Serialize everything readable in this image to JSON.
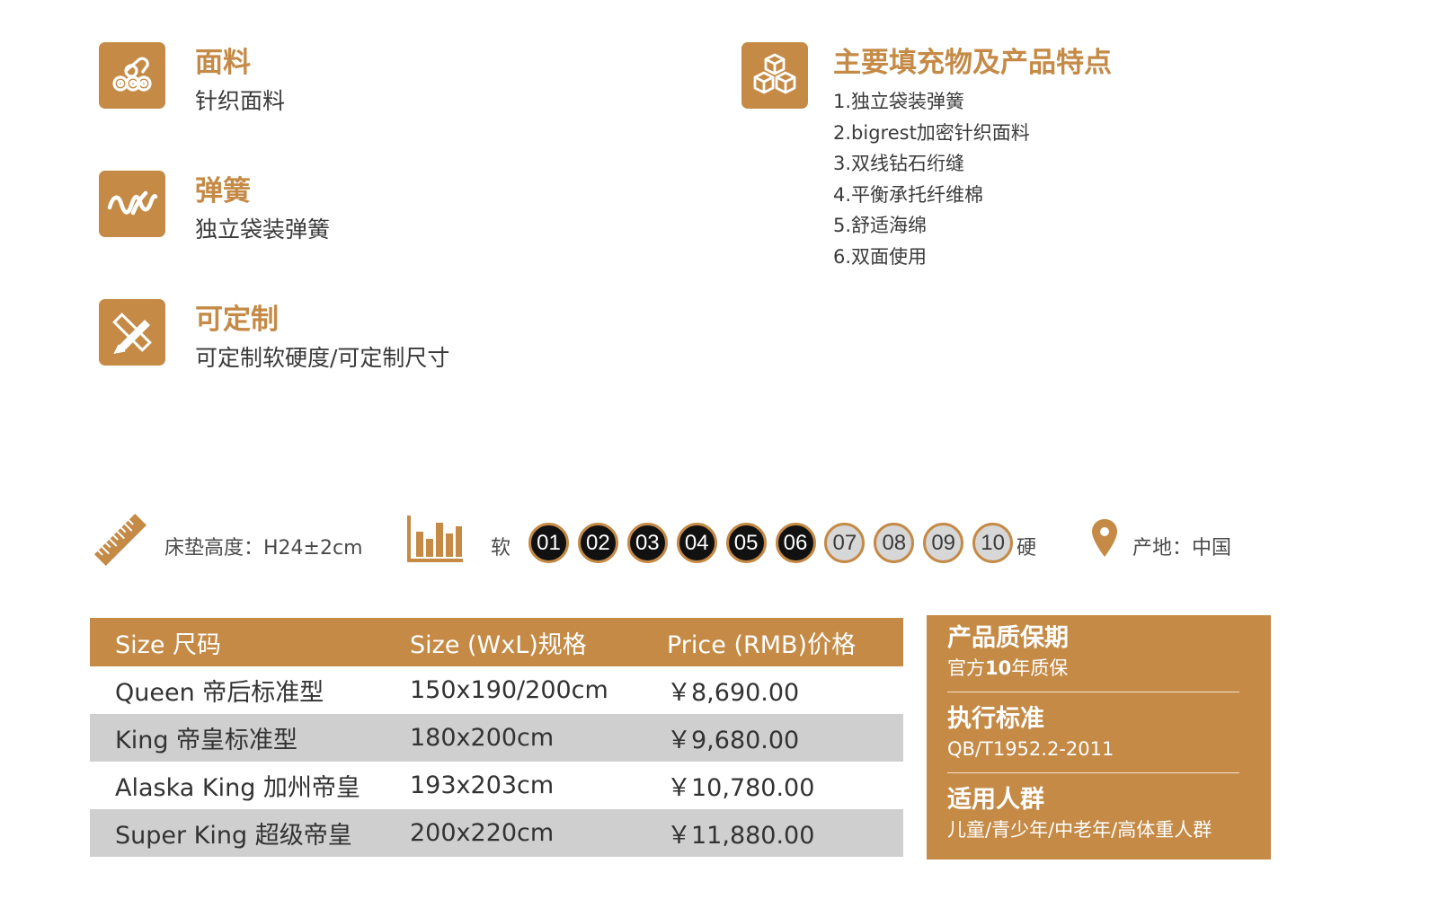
{
  "features": [
    {
      "title": "面料",
      "desc": "针织面料",
      "icon": "fabric-rolls-icon"
    },
    {
      "title": "弹簧",
      "desc": "独立袋装弹簧",
      "icon": "spring-wave-icon"
    },
    {
      "title": "可定制",
      "desc": "可定制软硬度/可定制尺寸",
      "icon": "pencil-ruler-icon"
    }
  ],
  "fillings": {
    "title": "主要填充物及产品特点",
    "icon": "cubes-icon",
    "items": [
      "1.独立袋装弹簧",
      "2.bigrest加密针织面料",
      "3.双线钻石绗缝",
      "4.平衡承托纤维棉",
      "5.舒适海绵",
      "6.双面使用"
    ]
  },
  "specs": {
    "height_text": "床垫高度：H24±2cm",
    "soft_label": "软",
    "hard_label": "硬",
    "levels": [
      "01",
      "02",
      "03",
      "04",
      "05",
      "06",
      "07",
      "08",
      "09",
      "10"
    ],
    "selected_level": 6,
    "origin_text": "产地：中国"
  },
  "table": {
    "headers": [
      "Size 尺码",
      "Size (WxL)规格",
      "Price (RMB)价格"
    ],
    "rows": [
      [
        "Queen 帝后标准型",
        "150x190/200cm",
        "￥8,690.00"
      ],
      [
        "King 帝皇标准型",
        "180x200cm",
        "￥9,680.00"
      ],
      [
        "Alaska King 加州帝皇",
        "193x203cm",
        "￥10,780.00"
      ],
      [
        "Super King 超级帝皇",
        "200x220cm",
        "￥11,880.00"
      ]
    ]
  },
  "info": {
    "warranty_title": "产品质保期",
    "warranty_prefix": "官方",
    "warranty_years": "10",
    "warranty_suffix": "年质保",
    "standard_title": "执行标准",
    "standard_value": "QB/T1952.2-2011",
    "audience_title": "适用人群",
    "audience_value": "儿童/青少年/中老年/高体重人群"
  },
  "colors": {
    "accent": "#c48a46",
    "dark_level": "#111111",
    "light_level": "#d7d7d7",
    "row_gray": "#cfcfcf"
  }
}
